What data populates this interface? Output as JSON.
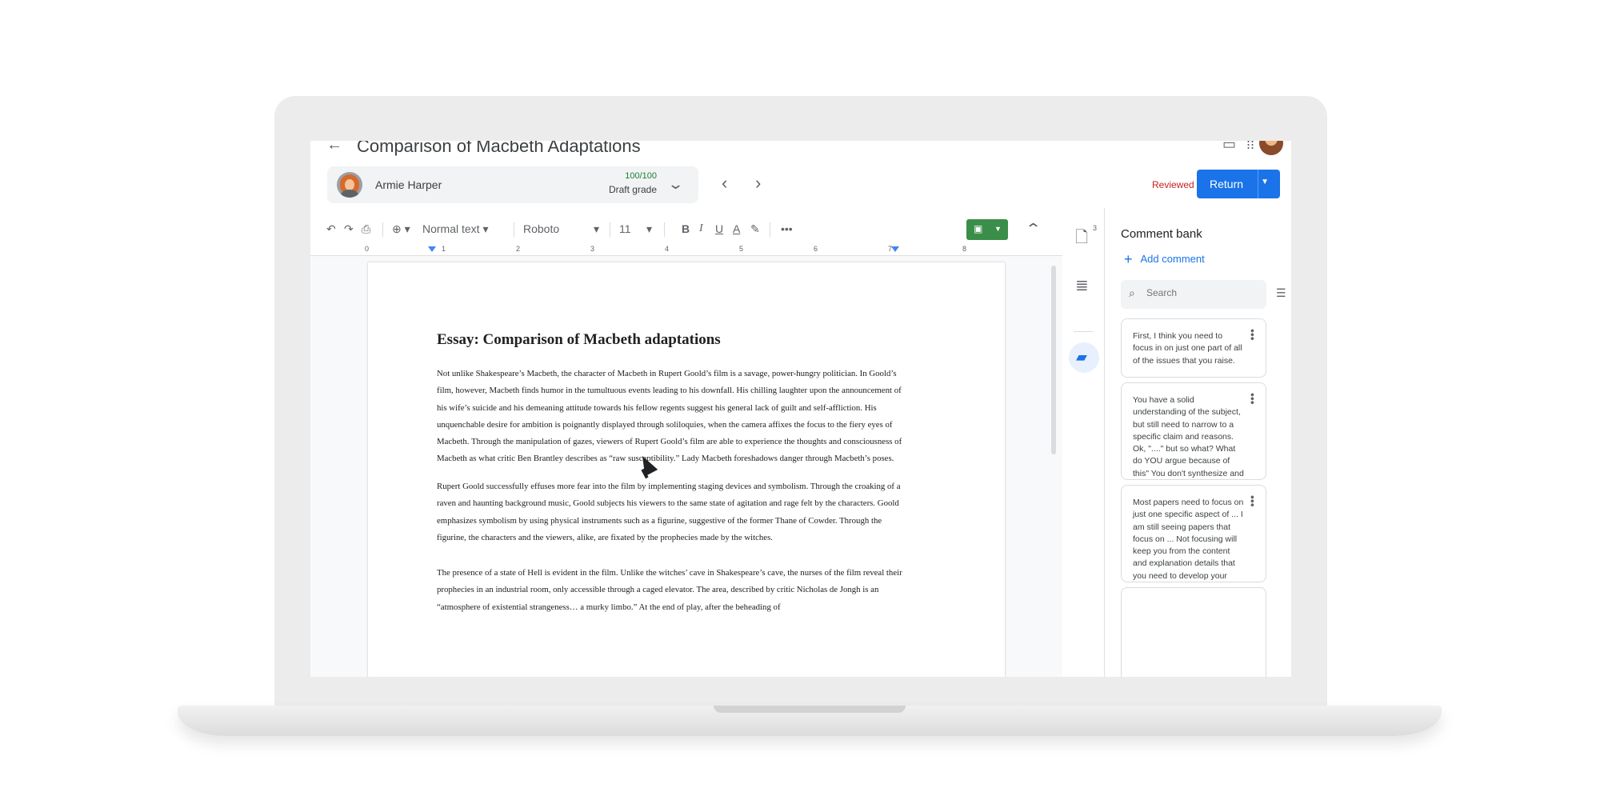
{
  "doc": {
    "title": "Comparison of Macbeth Adaptations"
  },
  "grading": {
    "student_name": "Armie Harper",
    "grade": "100/100",
    "grade_label": "Draft grade",
    "status": "Reviewed",
    "return_label": "Return"
  },
  "toolbar": {
    "style": "Normal text",
    "font": "Roboto",
    "font_size": "11"
  },
  "ruler": [
    "0",
    "1",
    "2",
    "3",
    "4",
    "5",
    "6",
    "7",
    "8"
  ],
  "rail": {
    "files_count": "3"
  },
  "essay": {
    "title": "Essay: Comparison of Macbeth adaptations",
    "paragraphs": [
      "Not unlike Shakespeare’s Macbeth, the character of Macbeth in Rupert Goold’s film is a savage, power-hungry politician. In Goold’s film, however, Macbeth finds humor in the tumultuous events leading to his downfall. His chilling laughter upon the announcement of his wife’s suicide and his demeaning attitude towards his fellow regents suggest his general lack of guilt and self-affliction. His unquenchable desire for ambition is poignantly displayed through soliloquies, when the camera affixes the focus to the fiery eyes of Macbeth. Through the manipulation of gazes, viewers of Rupert Goold’s film are able to experience the thoughts and consciousness of Macbeth as what critic Ben Brantley describes as “raw susceptibility.” Lady Macbeth foreshadows danger through Macbeth’s poses.",
      "Rupert Goold successfully effuses more fear into the film by implementing staging devices and symbolism. Through the croaking of a raven and haunting background music, Goold subjects his viewers to the same state of agitation and rage felt by the characters. Goold emphasizes symbolism by using physical instruments such as a figurine, suggestive of the former Thane of Cowder. Through the figurine, the characters and the viewers, alike, are fixated by the prophecies made by the witches.",
      "The presence of a state of Hell is evident in the film. Unlike the witches’ cave in Shakespeare’s cave, the nurses of the film reveal their prophecies in an industrial room, only accessible through a caged elevator. The area, described by critic Nicholas de Jongh is an “atmosphere of existential strangeness… a murky limbo.” At the end of play, after the beheading of"
    ]
  },
  "comment_bank": {
    "title": "Comment bank",
    "add_label": "Add comment",
    "search_placeholder": "Search",
    "comments": [
      "First, I think you need to focus in on just one part of all of the issues that you raise.",
      "You have a solid understanding of the subject, but still need to narrow to a specific claim and reasons. Ok, \"....\" but so what? What do YOU argue because of this\" You don't synthesize and develop YOUR argument",
      "Most papers need to focus on just one specific aspect of ... I am still seeing papers that focus on ... Not focusing will keep you from the content and explanation details that you need to develop your analysis."
    ]
  },
  "colors": {
    "accent": "#1a73e8",
    "grade_green": "#188038",
    "reviewed_red": "#c5221f",
    "tool_green": "#3b8e4a"
  }
}
